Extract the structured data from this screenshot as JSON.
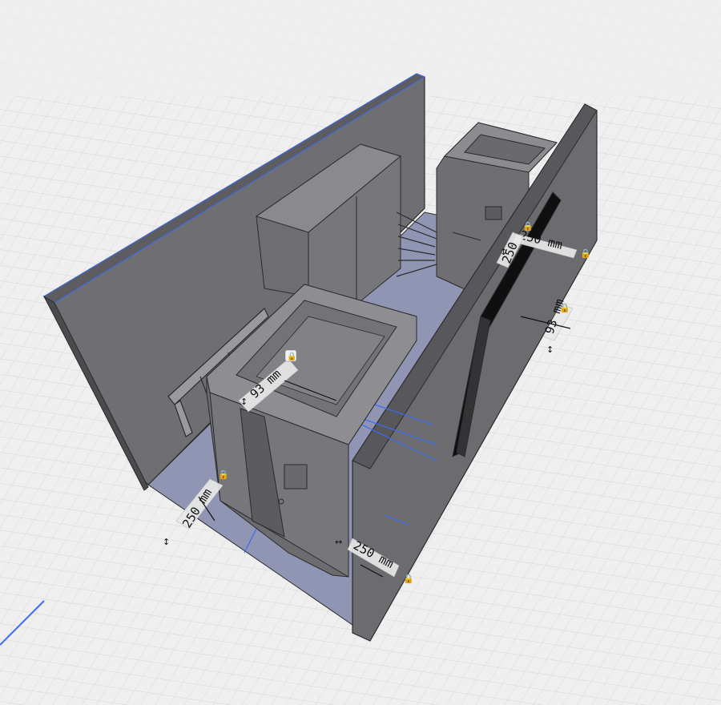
{
  "viewport": {
    "background": "#efefef",
    "grid_color": "#d4d4d4"
  },
  "colors": {
    "wall_face": "#6f6f73",
    "wall_edge": "#2b2b2b",
    "floor": "#8f95b3",
    "cabinet": "#77777b",
    "cabinet_light": "#8a8a8e",
    "cabinet_dark": "#5c5c60",
    "selection_blue": "#3a6df0"
  },
  "dimensions": {
    "top_tank_depth": "93 mm",
    "right_wall_offset": "93 mm",
    "right_top_width": "250 mm",
    "right_top_height": "250",
    "front_left": "250 mm",
    "front_right": "250 mm"
  },
  "icons": {
    "lock": "lock-icon",
    "resize": "resize-arrows-icon"
  }
}
